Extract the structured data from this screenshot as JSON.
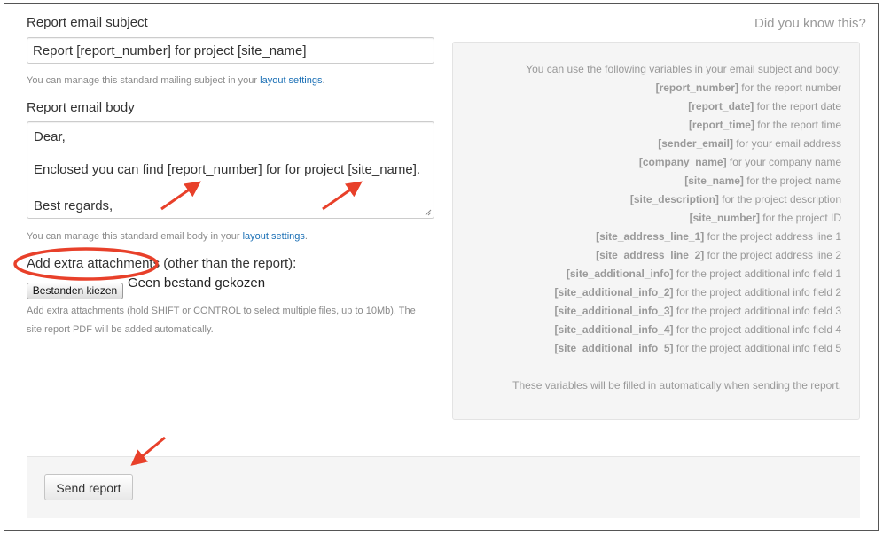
{
  "subject": {
    "label": "Report email subject",
    "value": "Report [report_number] for project [site_name]",
    "help_text": "You can manage this standard mailing subject in your ",
    "help_link": "layout settings",
    "help_suffix": "."
  },
  "body": {
    "label": "Report email body",
    "lines": [
      "Dear,",
      "Enclosed you can find [report_number] for for project [site_name].",
      "Best regards,"
    ],
    "help_text": "You can manage this standard email body in your ",
    "help_link": "layout settings",
    "help_suffix": "."
  },
  "attachments": {
    "label": "Add extra attachments (other than the report):",
    "button": "Bestanden kiezen",
    "status": "Geen bestand gekozen",
    "help_line1": "Add extra attachments (hold SHIFT or CONTROL to select multiple files, up to 10Mb). The",
    "help_line2": "site report PDF will be added automatically."
  },
  "info": {
    "title": "Did you know this?",
    "intro": "You can use the following variables in your email subject and body:",
    "variables": [
      {
        "name": "[report_number]",
        "desc": " for the report number"
      },
      {
        "name": "[report_date]",
        "desc": " for the report date"
      },
      {
        "name": "[report_time]",
        "desc": " for the report time"
      },
      {
        "name": "[sender_email]",
        "desc": " for your email address"
      },
      {
        "name": "[company_name]",
        "desc": " for your company name"
      },
      {
        "name": "[site_name]",
        "desc": " for the project name"
      },
      {
        "name": "[site_description]",
        "desc": " for the project description"
      },
      {
        "name": "[site_number]",
        "desc": " for the project ID"
      },
      {
        "name": "[site_address_line_1]",
        "desc": " for the project address line 1"
      },
      {
        "name": "[site_address_line_2]",
        "desc": " for the project address line 2"
      },
      {
        "name": "[site_additional_info]",
        "desc": " for the project additional info field 1"
      },
      {
        "name": "[site_additional_info_2]",
        "desc": " for the project additional info field 2"
      },
      {
        "name": "[site_additional_info_3]",
        "desc": " for the project additional info field 3"
      },
      {
        "name": "[site_additional_info_4]",
        "desc": " for the project additional info field 4"
      },
      {
        "name": "[site_additional_info_5]",
        "desc": " for the project additional info field 5"
      }
    ],
    "outro": "These variables will be filled in automatically when sending the report."
  },
  "footer": {
    "send_label": "Send report"
  },
  "colors": {
    "annotation": "#e8402a",
    "link": "#1a6fb5"
  }
}
